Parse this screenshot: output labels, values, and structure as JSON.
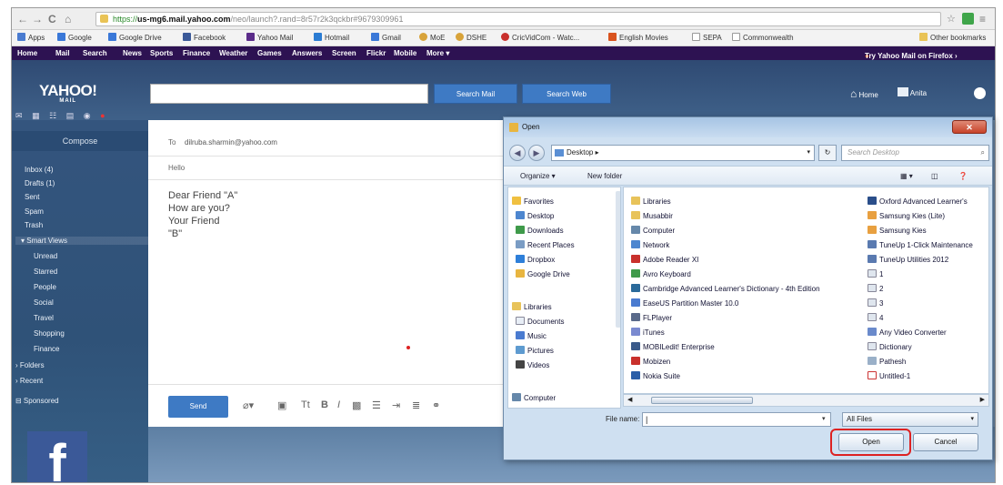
{
  "browser": {
    "url_prefix": "https://",
    "url_host": "us-mg6.mail.yahoo.com",
    "url_rest": "/neo/launch?.rand=8r57r2k3qckbr#9679309961",
    "back": "←",
    "forward": "→",
    "reload": "C",
    "home": "⌂",
    "star": "☆",
    "menu": "≡"
  },
  "bookmarks": {
    "items": [
      "Apps",
      "Google",
      "Google Drive",
      "Facebook",
      "Yahoo Mail",
      "Hotmail",
      "Gmail",
      "MoE",
      "DSHE",
      "CricVidCom - Watc...",
      "English Movies",
      "SEPA",
      "Commonwealth"
    ],
    "other": "Other bookmarks"
  },
  "yahoo_nav": {
    "items": [
      "Home",
      "Mail",
      "Search",
      "News",
      "Sports",
      "Finance",
      "Weather",
      "Games",
      "Answers",
      "Screen",
      "Flickr",
      "Mobile",
      "More ▾"
    ],
    "promo": "Try Yahoo Mail on Firefox ›"
  },
  "header": {
    "logo": "YAHOO!",
    "logo_sub": "MAIL",
    "search_mail": "Search Mail",
    "search_web": "Search Web",
    "home": "Home",
    "user": "Anita"
  },
  "sidebar": {
    "compose": "Compose",
    "items": [
      "Inbox (4)",
      "Drafts (1)",
      "Sent",
      "Spam",
      "Trash",
      "▾ Smart Views",
      "Unread",
      "Starred",
      "People",
      "Social",
      "Travel",
      "Shopping",
      "Finance",
      "› Folders",
      "› Recent",
      "⊟ Sponsored"
    ]
  },
  "compose": {
    "to_label": "To",
    "to": "dilruba.sharmin@yahoo.com",
    "subject": "Hello",
    "body_lines": [
      "Dear Friend \"A\"",
      "",
      "How are you?",
      "",
      "Your Friend",
      "\"B\""
    ],
    "send": "Send"
  },
  "dialog": {
    "title": "Open",
    "path": "Desktop ▸",
    "search_placeholder": "Search Desktop",
    "organize": "Organize ▾",
    "new_folder": "New folder",
    "nav": {
      "favorites_label": "Favorites",
      "favorites": [
        "Desktop",
        "Downloads",
        "Recent Places",
        "Dropbox",
        "Google Drive"
      ],
      "libraries_label": "Libraries",
      "libraries": [
        "Documents",
        "Music",
        "Pictures",
        "Videos"
      ],
      "computer": "Computer"
    },
    "files_col1": [
      "Libraries",
      "Musabbir",
      "Computer",
      "Network",
      "Adobe Reader XI",
      "Avro Keyboard",
      "Cambridge Advanced Learner's Dictionary - 4th Edition",
      "EaseUS Partition Master 10.0",
      "FLPlayer",
      "iTunes",
      "MOBILedit! Enterprise",
      "Mobizen",
      "Nokia Suite"
    ],
    "files_col2": [
      "Oxford Advanced Learner's",
      "Samsung Kies (Lite)",
      "Samsung Kies",
      "TuneUp 1-Click Maintenance",
      "TuneUp Utilities 2012",
      "1",
      "2",
      "3",
      "4",
      "Any Video Converter",
      "Dictionary",
      "Pathesh",
      "Untitled-1"
    ],
    "file_name_label": "File name:",
    "file_name_value": "",
    "filter": "All Files",
    "open": "Open",
    "cancel": "Cancel"
  }
}
